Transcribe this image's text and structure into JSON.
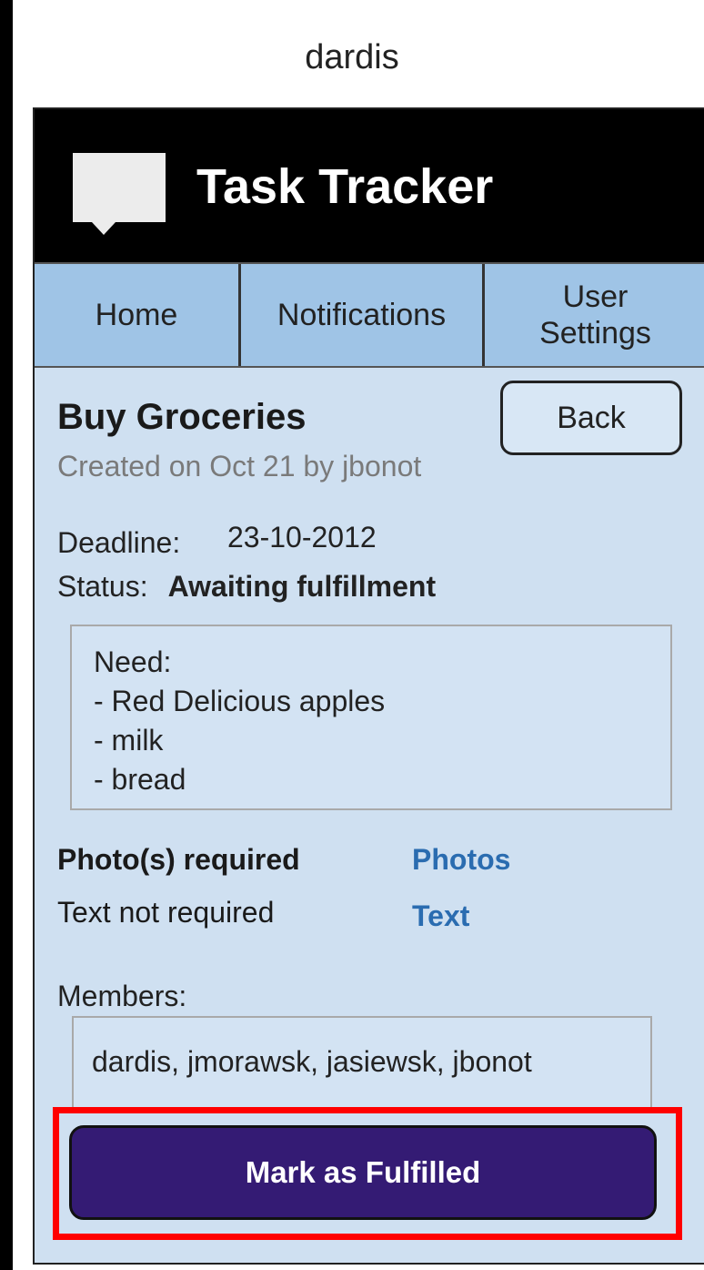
{
  "user_label": "dardis",
  "header": {
    "app_title": "Task Tracker"
  },
  "tabs": {
    "home": "Home",
    "notifications": "Notifications",
    "user_settings": "User Settings"
  },
  "task": {
    "title": "Buy Groceries",
    "created": "Created on Oct 21 by jbonot",
    "back_label": "Back",
    "deadline_label": "Deadline:",
    "deadline_value": "23-10-2012",
    "status_label": "Status:",
    "status_value": "Awaiting fulfillment",
    "description": [
      "Need:",
      "- Red Delicious apples",
      "- milk",
      "- bread"
    ],
    "photos_requirement": "Photo(s) required",
    "photos_link": "Photos",
    "text_requirement": "Text not required",
    "text_link": "Text",
    "members_label": "Members:",
    "members": "dardis, jmorawsk, jasiewsk, jbonot",
    "fulfill_label": "Mark as Fulfilled"
  },
  "colors": {
    "header_bg": "#000000",
    "tab_bg": "#9fc4e6",
    "content_bg": "#cfe0f1",
    "link": "#2a6cb0",
    "primary_button": "#341b74",
    "highlight": "#ff0000"
  },
  "icons": {
    "logo": "speech-bubble-logo-icon"
  }
}
